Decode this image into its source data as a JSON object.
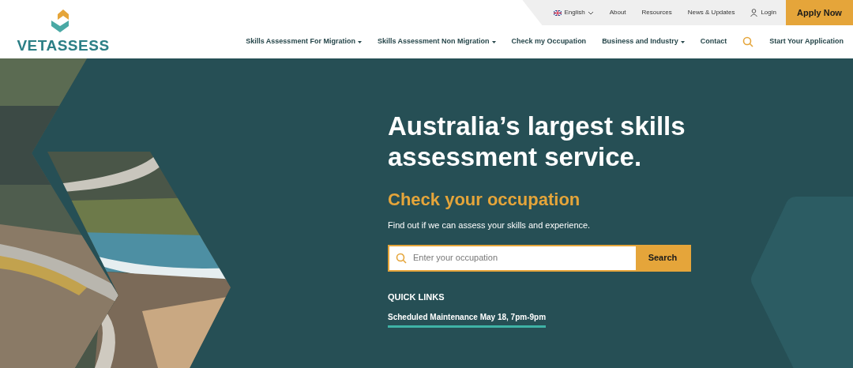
{
  "logo": {
    "text": "VETASSESS"
  },
  "top_bar": {
    "language": "English",
    "links": [
      "About",
      "Resources",
      "News & Updates"
    ],
    "login": "Login",
    "apply": "Apply Now"
  },
  "nav": [
    {
      "label": "Skills Assessment For Migration",
      "dropdown": true
    },
    {
      "label": "Skills Assessment Non Migration",
      "dropdown": true
    },
    {
      "label": "Check my Occupation",
      "dropdown": false
    },
    {
      "label": "Business and Industry",
      "dropdown": true
    },
    {
      "label": "Contact",
      "dropdown": false
    }
  ],
  "nav_cta": "Start Your Application",
  "hero": {
    "kind": "picture",
    "heading": "Australia’s largest skills assessment service.",
    "subheading": "Check your occupation",
    "text": "Find out if we can assess your skills and experience.",
    "search": {
      "placeholder": "Enter your occupation",
      "button": "Search"
    },
    "quick_links": {
      "title": "QUICK LINKS",
      "links": [
        "Scheduled Maintenance May 18, 7pm-9pm"
      ]
    }
  }
}
